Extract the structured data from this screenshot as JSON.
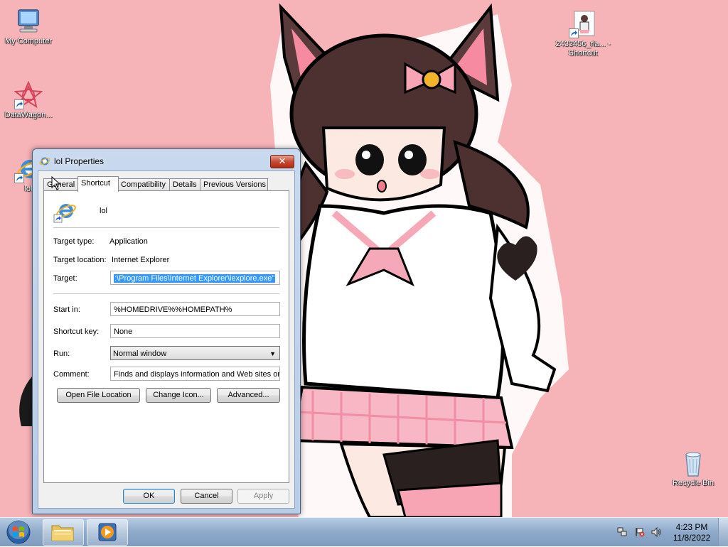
{
  "desktop": {
    "icons": [
      {
        "label": "My Computer"
      },
      {
        "label": "DataWagon..."
      },
      {
        "label": "lol"
      },
      {
        "label": "2433456_ria... - Shortcut"
      },
      {
        "label": "Recycle Bin"
      }
    ]
  },
  "dialog": {
    "title": "lol Properties",
    "close_label": "✕",
    "tabs": [
      "General",
      "Shortcut",
      "Compatibility",
      "Details",
      "Previous Versions"
    ],
    "active_tab": "Shortcut",
    "shortcut_name": "lol",
    "fields": {
      "target_type_label": "Target type:",
      "target_type_value": "Application",
      "target_location_label": "Target location:",
      "target_location_value": "Internet Explorer",
      "target_label": "Target:",
      "target_value": ":\\Program Files\\Internet Explorer\\iexplore.exe\"",
      "start_in_label": "Start in:",
      "start_in_value": "%HOMEDRIVE%%HOMEPATH%",
      "shortcut_key_label": "Shortcut key:",
      "shortcut_key_value": "None",
      "run_label": "Run:",
      "run_value": "Normal window",
      "comment_label": "Comment:",
      "comment_value": "Finds and displays information and Web sites on"
    },
    "buttons": {
      "open_file_location": "Open File Location",
      "change_icon": "Change Icon...",
      "advanced": "Advanced...",
      "ok": "OK",
      "cancel": "Cancel",
      "apply": "Apply"
    }
  },
  "taskbar": {
    "clock_time": "4:23 PM",
    "clock_date": "11/8/2022"
  },
  "colors": {
    "wallpaper": "#f6b3b8",
    "selection": "#3399ff",
    "close_button": "#c74b35"
  }
}
